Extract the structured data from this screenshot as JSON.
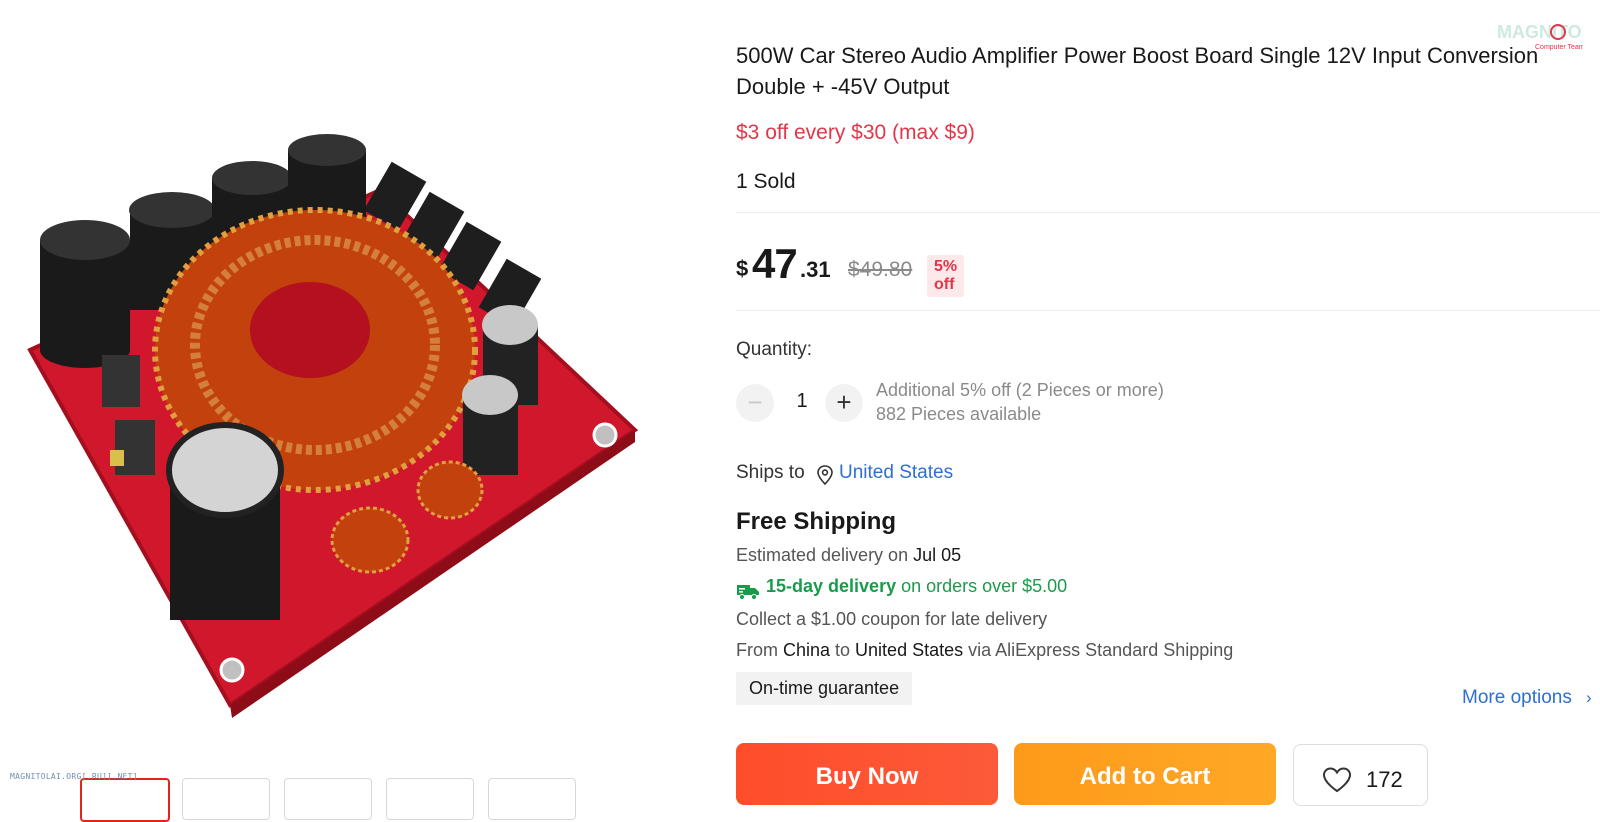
{
  "product": {
    "title": "500W Car Stereo Audio Amplifier Power Boost Board Single 12V Input Conversion Double + -45V Output",
    "promo": "$3 off every $30 (max $9)",
    "sold": "1 Sold"
  },
  "price": {
    "currency": "$",
    "integer": "47",
    "decimal": ".31",
    "original": "$49.80",
    "discount_badge": "5% off"
  },
  "quantity": {
    "label": "Quantity:",
    "minus": "−",
    "value": "1",
    "plus": "+",
    "bulk_note": "Additional 5% off (2 Pieces or more)",
    "available": "882 Pieces available"
  },
  "shipping": {
    "ships_to_label": "Ships to",
    "destination": "United States",
    "headline": "Free Shipping",
    "est_prefix": "Estimated delivery on ",
    "est_date": "Jul 05",
    "fast_bold": "15-day delivery",
    "fast_rest": " on orders over $5.00",
    "coupon": "Collect a $1.00 coupon for late delivery",
    "route_from": "From ",
    "route_origin": "China",
    "route_to": " to ",
    "route_dest": "United States",
    "route_via": " via AliExpress Standard Shipping",
    "guarantee": "On-time guarantee",
    "more_options": "More options",
    "chevron": "›"
  },
  "actions": {
    "buy_now": "Buy Now",
    "add_to_cart": "Add to Cart",
    "wishlist_count": "172"
  },
  "watermarks": {
    "bottom_left": "MAGNITOLAI.ORG[.RU][.NET]",
    "logo_text": "MAGNITOLA",
    "logo_sub": "Computer Team"
  },
  "icons": {
    "location": "location-pin-icon",
    "truck": "truck-icon",
    "heart": "heart-icon"
  },
  "colors": {
    "promo_red": "#e2364a",
    "link_blue": "#2e6fd0",
    "fast_green": "#1a9b4b",
    "buy_red": "#ff4d2a",
    "cart_orange": "#ffa826"
  }
}
